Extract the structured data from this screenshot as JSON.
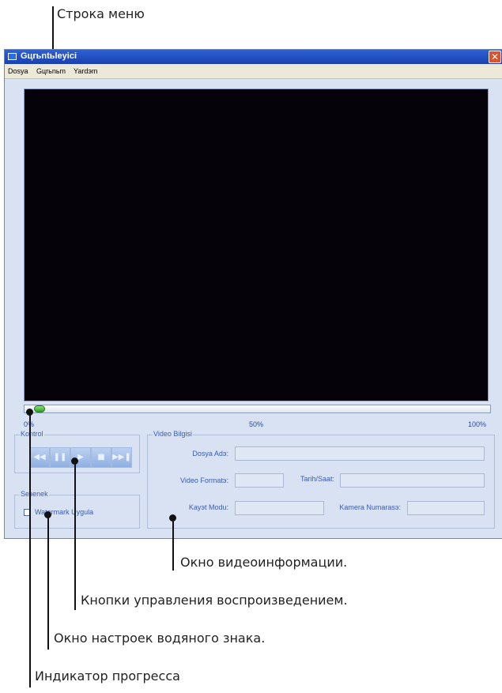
{
  "callouts": {
    "menu_bar": "Строка меню",
    "video_info": "Окно видеоинформации.",
    "playback_controls": "Кнопки управления воспроизведением.",
    "watermark": "Окно настроек водяного знака.",
    "progress": "Индикатор прогресса"
  },
  "window": {
    "title": "Gцrьntьleyici",
    "close_glyph": "✕"
  },
  "menu": {
    "items": [
      "Dosya",
      "Gцrьnьm",
      "Yardэm"
    ]
  },
  "progress": {
    "value_percent": 2,
    "labels": [
      "0%",
      "50%",
      "100%"
    ]
  },
  "control": {
    "title": "Kontrol",
    "buttons": [
      "◀◀",
      "❚❚",
      "▶",
      "■",
      "▶▶❚"
    ]
  },
  "option": {
    "title": "Seзenek",
    "watermark_label": "Watermark Uygula",
    "watermark_checked": false
  },
  "video_info": {
    "title": "Video Bilgisi",
    "file_name_label": "Dosya Adэ:",
    "file_name_value": "",
    "format_label": "Video Formatэ:",
    "format_value": "",
    "datetime_label": "Tarih/Saat:",
    "datetime_value": "",
    "record_mode_label": "Kayэt Modu:",
    "record_mode_value": "",
    "camera_label": "Kamera Numarasэ:",
    "camera_value": ""
  }
}
